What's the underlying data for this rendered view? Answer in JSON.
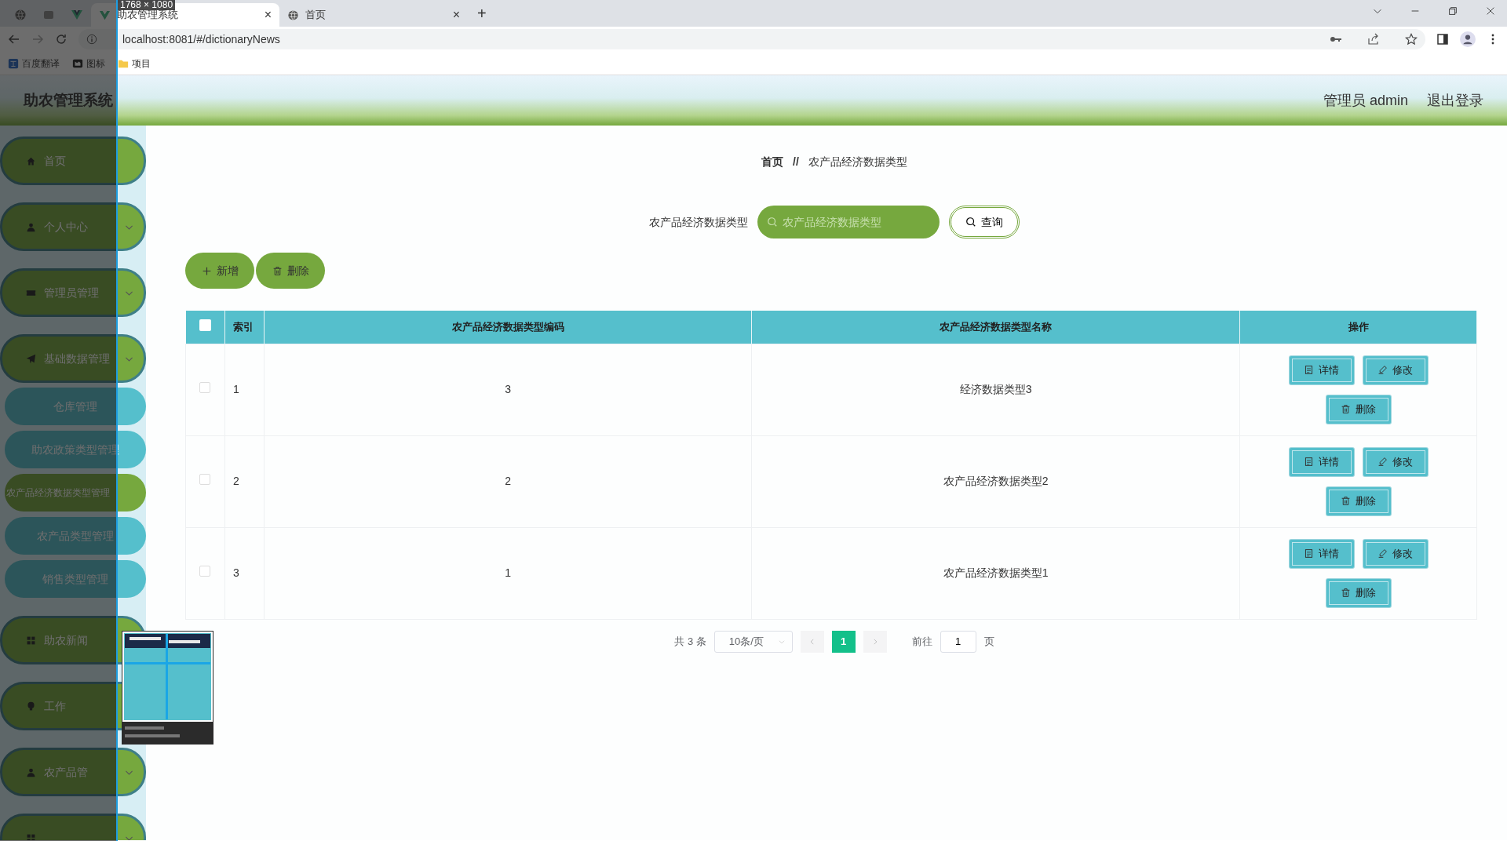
{
  "browser": {
    "tabs": [
      {
        "title": "助农管理系统",
        "selected": true,
        "close": "×"
      },
      {
        "title": "首页",
        "selected": false,
        "close": "×"
      }
    ],
    "new_tab": "+",
    "url": "localhost:8081/#/dictionaryNews",
    "bookmarks": [
      {
        "kind": "translate",
        "label": "百度翻译"
      },
      {
        "kind": "flag",
        "label": "图标"
      },
      {
        "kind": "folder",
        "label": "项目"
      }
    ]
  },
  "screenshot_tool": {
    "size_label": "1768 × 1080"
  },
  "header": {
    "title": "助农管理系统",
    "user": "管理员 admin",
    "logout": "退出登录"
  },
  "sidebar": {
    "items": [
      {
        "kind": "home",
        "label": "首页",
        "submenu": false
      },
      {
        "kind": "person",
        "label": "个人中心",
        "submenu": true
      },
      {
        "kind": "ticket",
        "label": "管理员管理",
        "submenu": true
      },
      {
        "kind": "plane",
        "label": "基础数据管理",
        "submenu": true,
        "children": [
          {
            "label": "仓库管理",
            "selected": false
          },
          {
            "label": "助农政策类型管理",
            "selected": false
          },
          {
            "label": "农产品经济数据类型管理",
            "selected": true
          },
          {
            "label": "农产品类型管理",
            "selected": false
          },
          {
            "label": "销售类型管理",
            "selected": false
          }
        ]
      },
      {
        "kind": "grid",
        "label": "助农新闻"
      },
      {
        "kind": "bulb",
        "label": "工作"
      },
      {
        "kind": "person",
        "label": "农产品管",
        "submenu": true
      },
      {
        "kind": "grid",
        "submenu": true
      }
    ]
  },
  "breadcrumb": [
    {
      "label": "首页"
    },
    {
      "label": "农产品经济数据类型"
    }
  ],
  "breadcrumb_separator": "//",
  "search": {
    "label": "农产品经济数据类型",
    "placeholder": "农产品经济数据类型",
    "button": "查询"
  },
  "actions": [
    {
      "kind": "add",
      "label": "新增"
    },
    {
      "kind": "delete",
      "label": "删除"
    }
  ],
  "table": {
    "select_all_checked": false,
    "columns": [
      "索引",
      "农产品经济数据类型编码",
      "农产品经济数据类型名称",
      "操作"
    ],
    "rows": [
      {
        "checked": false,
        "index": "1",
        "code": "3",
        "name": "经济数据类型3",
        "actions": [
          {
            "kind": "detail",
            "label": "详情"
          },
          {
            "kind": "edit",
            "label": "修改"
          },
          {
            "kind": "delete",
            "label": "删除"
          }
        ]
      },
      {
        "checked": false,
        "index": "2",
        "code": "2",
        "name": "农产品经济数据类型2",
        "actions": [
          {
            "kind": "detail",
            "label": "详情"
          },
          {
            "kind": "edit",
            "label": "修改"
          },
          {
            "kind": "delete",
            "label": "删除"
          }
        ]
      },
      {
        "checked": false,
        "index": "3",
        "code": "1",
        "name": "农产品经济数据类型1",
        "actions": [
          {
            "kind": "detail",
            "label": "详情"
          },
          {
            "kind": "edit",
            "label": "修改"
          },
          {
            "kind": "delete",
            "label": "删除"
          }
        ]
      }
    ]
  },
  "pagination": {
    "total": "共 3 条",
    "page_size": "10条/页",
    "pages": [
      {
        "label": "1",
        "selected": true
      }
    ],
    "goto_label": "前往",
    "goto_value": "1",
    "goto_suffix": "页"
  }
}
